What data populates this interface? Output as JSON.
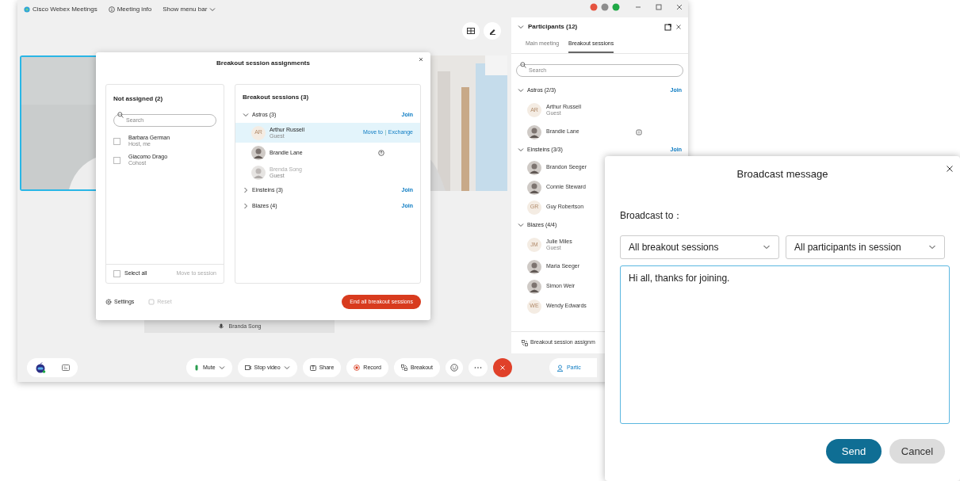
{
  "app": {
    "title": "Cisco Webex Meetings",
    "meeting_info": "Meeting info",
    "menu_bar": "Show menu bar"
  },
  "video": {
    "name_label": "Branda Song"
  },
  "assignments": {
    "title": "Breakout session assignments",
    "unassigned": {
      "heading": "Not assigned (2)",
      "search_placeholder": "Search",
      "people": [
        {
          "name": "Barbara German",
          "role": "Host, me",
          "checked": false
        },
        {
          "name": "Giacomo Drago",
          "role": "Cohost",
          "checked": false
        }
      ],
      "select_all": {
        "label": "Select all",
        "checked": false
      },
      "move_button": {
        "label": "Move to session",
        "disabled": true
      }
    },
    "sessions": {
      "heading": "Breakout sessions (3)",
      "list": [
        {
          "name": "Astros (3)",
          "expanded": true,
          "join": "Join",
          "members": [
            {
              "name": "Arthur Russell",
              "role": "Guest",
              "kind": "initials",
              "initials": "AR",
              "hovered": true,
              "disabled": false,
              "badge": false,
              "actions": [
                "Move to",
                "Exchange"
              ]
            },
            {
              "name": "Brandie Lane",
              "hovered": false,
              "disabled": false,
              "badge": true
            },
            {
              "name": "Brenda Song",
              "role": "Guest",
              "hovered": false,
              "disabled": true,
              "badge": false
            }
          ]
        },
        {
          "name": "Einsteins (3)",
          "expanded": false,
          "join": "Join"
        },
        {
          "name": "Blazes (4)",
          "expanded": false,
          "join": "Join"
        }
      ]
    },
    "footer": {
      "settings": "Settings",
      "reset": {
        "label": "Reset",
        "disabled": true
      },
      "end": "End all breakout sessions"
    }
  },
  "participants": {
    "title": "Participants (12)",
    "tabs": [
      {
        "label": "Main meeting",
        "selected": false
      },
      {
        "label": "Breakout sessions",
        "selected": true
      }
    ],
    "search_placeholder": "Search",
    "sessions": [
      {
        "name": "Astros (2/3)",
        "expanded": true,
        "join": "Join",
        "members": [
          {
            "name": "Arthur Russell",
            "role": "Guest",
            "kind": "initials",
            "initials": "AR",
            "badge": false
          },
          {
            "name": "Brandie Lane",
            "badge": true
          }
        ]
      },
      {
        "name": "Einsteins (3/3)",
        "expanded": true,
        "join": "Join",
        "members": [
          {
            "name": "Brandon Seeger",
            "badge": false
          },
          {
            "name": "Connie Steward",
            "badge": false
          },
          {
            "name": "Guy Robertson",
            "kind": "initials",
            "initials": "GR",
            "badge": false
          }
        ]
      },
      {
        "name": "Blazes (4/4)",
        "expanded": true,
        "members": [
          {
            "name": "Julie Miles",
            "role": "Guest",
            "kind": "initials",
            "initials": "JM",
            "badge": false
          },
          {
            "name": "Maria Seeger",
            "badge": false
          },
          {
            "name": "Simon Weir",
            "badge": false
          },
          {
            "name": "Wendy Edwards",
            "kind": "initials",
            "initials": "WE",
            "badge": false
          }
        ]
      }
    ],
    "footer": "Breakout session assignm"
  },
  "toolbar": {
    "buttons": [
      {
        "label": "Mute",
        "kind": "mic",
        "dropdown": true
      },
      {
        "label": "Stop video",
        "kind": "video",
        "dropdown": true
      },
      {
        "label": "Share",
        "kind": "share",
        "dropdown": false
      },
      {
        "label": "Record",
        "kind": "record",
        "dropdown": false
      },
      {
        "label": "Breakout",
        "kind": "breakout",
        "dropdown": false
      }
    ],
    "participants_button": "Partic"
  },
  "broadcast": {
    "title": "Broadcast message",
    "to_label": "Broadcast to：",
    "targets": [
      "All breakout sessions",
      "All participants in session"
    ],
    "message": "Hi all, thanks for joining.",
    "buttons": [
      {
        "label": "Send",
        "kind": "primary"
      },
      {
        "label": "Cancel",
        "kind": "secondary"
      }
    ]
  }
}
